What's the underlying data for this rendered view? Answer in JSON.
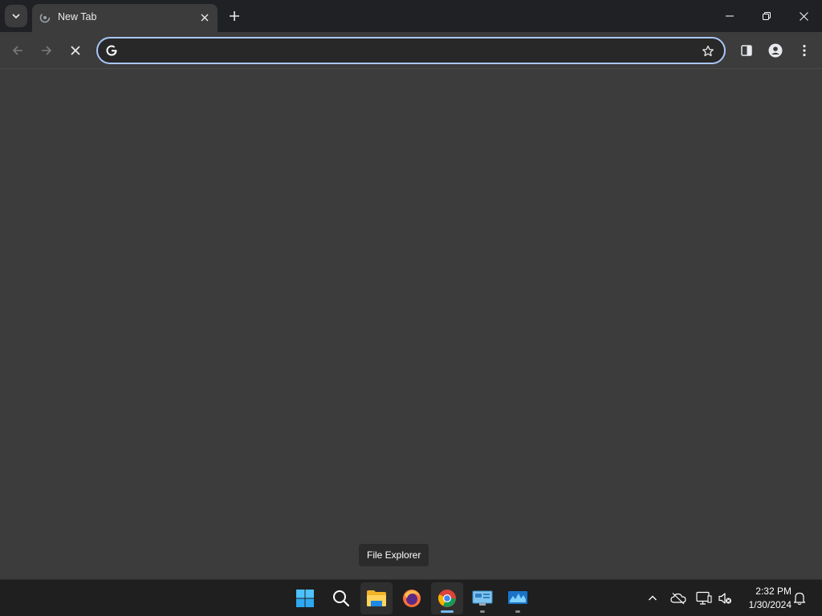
{
  "browser": {
    "tab": {
      "title": "New Tab"
    },
    "omnibox": {
      "value": "",
      "placeholder": ""
    }
  },
  "tooltip": {
    "text": "File Explorer"
  },
  "taskbar": {
    "apps": [
      {
        "name": "Start",
        "icon": "windows-start-icon"
      },
      {
        "name": "Search",
        "icon": "search-icon"
      },
      {
        "name": "File Explorer",
        "icon": "file-explorer-icon",
        "hovered": true
      },
      {
        "name": "Firefox",
        "icon": "firefox-icon"
      },
      {
        "name": "Google Chrome",
        "icon": "chrome-icon",
        "active": true
      },
      {
        "name": "Control Panel",
        "icon": "control-panel-icon",
        "running": true
      },
      {
        "name": "Task Manager",
        "icon": "monitor-app-icon",
        "running": true
      }
    ],
    "clock": {
      "time": "2:32 PM",
      "date": "1/30/2024"
    }
  },
  "colors": {
    "titlebar": "#202124",
    "toolbar": "#3c3c3c",
    "omnibox_border": "#a8c7fa",
    "taskbar": "#1f1f1f",
    "active_indicator": "#76b9ed"
  }
}
